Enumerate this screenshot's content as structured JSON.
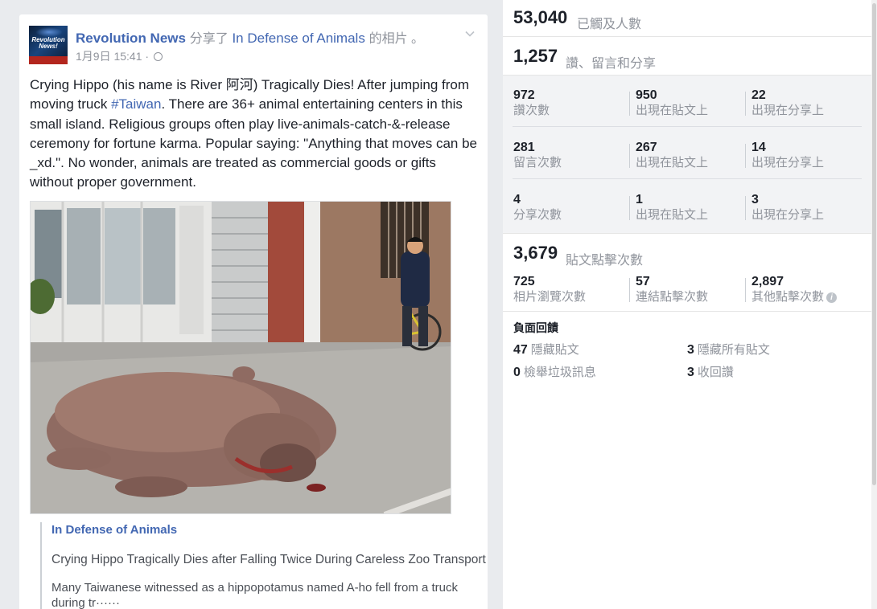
{
  "post": {
    "page_name": "Revolution News",
    "shared_text": "分享了",
    "shared_page": "In Defense of Animals",
    "shared_suffix": "的相片 。",
    "date": "1月9日 15:41 ·",
    "avatar_text": "Revolution News!",
    "body_before_hashtag": "Crying Hippo (his name is River 阿河) Tragically Dies! After jumping from moving truck ",
    "hashtag": "#Taiwan",
    "body_after_hashtag": ". There are 36+ animal entertaining centers in this small island. Religious groups often play live-animals-catch-&-release ceremony for fortune karma. Popular saying: \"Anything that moves can be _xd.\". No wonder, animals are treated as commercial goods or gifts without proper government.",
    "photo_icon": "hippo-street-photo",
    "link": {
      "source": "In Defense of Animals",
      "headline": "Crying Hippo Tragically Dies after Falling Twice During Careless Zoo Transport",
      "description": "Many Taiwanese witnessed as a hippopotamus named A-ho fell from a truck during tr······"
    }
  },
  "insights": {
    "reach": {
      "value": "53,040",
      "label": "已觸及人數"
    },
    "engagement": {
      "value": "1,257",
      "label": "讚、留言和分享"
    },
    "rows": [
      {
        "cells": [
          {
            "value": "972",
            "label": "讚次數"
          },
          {
            "value": "950",
            "label": "出現在貼文上"
          },
          {
            "value": "22",
            "label": "出現在分享上"
          }
        ]
      },
      {
        "cells": [
          {
            "value": "281",
            "label": "留言次數"
          },
          {
            "value": "267",
            "label": "出現在貼文上"
          },
          {
            "value": "14",
            "label": "出現在分享上"
          }
        ]
      },
      {
        "cells": [
          {
            "value": "4",
            "label": "分享次數"
          },
          {
            "value": "1",
            "label": "出現在貼文上"
          },
          {
            "value": "3",
            "label": "出現在分享上"
          }
        ]
      }
    ],
    "clicks": {
      "value": "3,679",
      "label": "貼文點擊次數"
    },
    "click_cells": [
      {
        "value": "725",
        "label": "相片瀏覽次數"
      },
      {
        "value": "57",
        "label": "連結點擊次數"
      },
      {
        "value": "2,897",
        "label": "其他點擊次數"
      }
    ],
    "info_icon": "i",
    "negative": {
      "title": "負面回饋",
      "items": [
        {
          "value": "47",
          "label": "隱藏貼文"
        },
        {
          "value": "3",
          "label": "隱藏所有貼文"
        },
        {
          "value": "0",
          "label": "檢舉垃圾訊息"
        },
        {
          "value": "3",
          "label": "收回讚"
        }
      ]
    }
  },
  "colors": {
    "link": "#4267b2",
    "muted": "#90949c",
    "text": "#1d2129",
    "stats_bg": "#f2f3f5"
  }
}
